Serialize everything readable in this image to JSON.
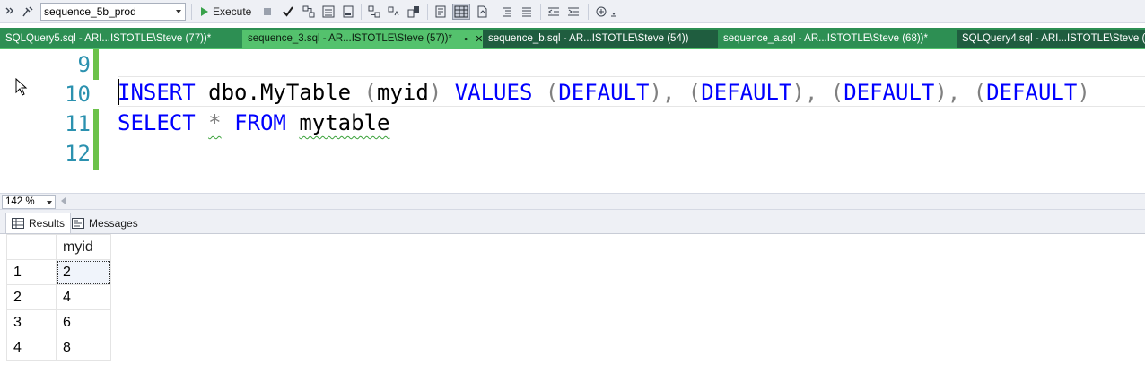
{
  "toolbar": {
    "database": "sequence_5b_prod",
    "execute_label": "Execute"
  },
  "tabs": [
    {
      "label": "SQLQuery5.sql - ARI...ISTOTLE\\Steve (77))*"
    },
    {
      "label": "sequence_3.sql - AR...ISTOTLE\\Steve (57))*"
    },
    {
      "label": "sequence_b.sql - AR...ISTOTLE\\Steve (54))"
    },
    {
      "label": "sequence_a.sql - AR...ISTOTLE\\Steve (68))*"
    },
    {
      "label": "SQLQuery4.sql - ARI...ISTOTLE\\Steve (5"
    }
  ],
  "editor": {
    "line_numbers": [
      "9",
      "10",
      "11",
      "12"
    ],
    "line10": {
      "kw_insert": "INSERT",
      "obj": " dbo.MyTable ",
      "p1": "(",
      "col": "myid",
      "p2": ")",
      "kw_values": " VALUES ",
      "g1": "(",
      "d1": "DEFAULT",
      "g2": "), (",
      "d2": "DEFAULT",
      "g3": "), (",
      "d3": "DEFAULT",
      "g4": "), (",
      "d4": "DEFAULT",
      "g5": ")"
    },
    "line11": {
      "kw_select": "SELECT",
      "star": "*",
      "kw_from": "FROM",
      "table": "mytable"
    }
  },
  "zoom": "142 %",
  "results_tabs": {
    "results": "Results",
    "messages": "Messages"
  },
  "grid": {
    "column": "myid",
    "rows": [
      {
        "n": "1",
        "v": "2"
      },
      {
        "n": "2",
        "v": "4"
      },
      {
        "n": "3",
        "v": "6"
      },
      {
        "n": "4",
        "v": "8"
      }
    ]
  }
}
